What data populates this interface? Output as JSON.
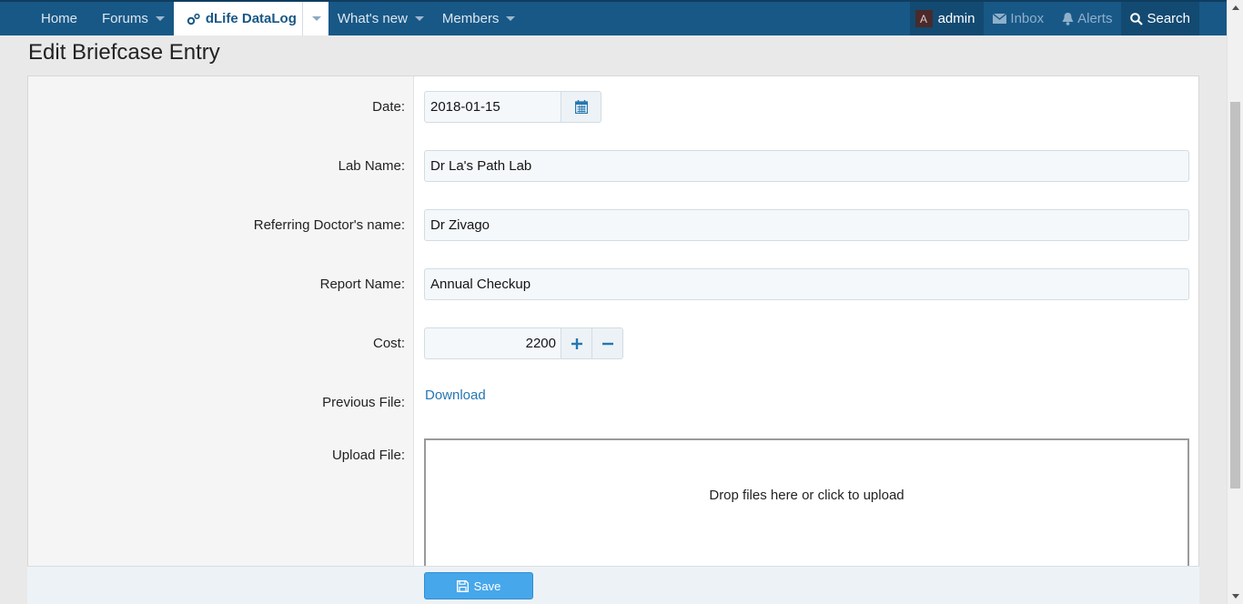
{
  "nav": {
    "items": [
      {
        "label": "Home"
      },
      {
        "label": "Forums"
      },
      {
        "label": "dLife DataLog"
      },
      {
        "label": "What's new"
      },
      {
        "label": "Members"
      }
    ],
    "user": {
      "avatar_letter": "A",
      "name": "admin"
    },
    "inbox_label": "Inbox",
    "alerts_label": "Alerts",
    "search_label": "Search"
  },
  "page": {
    "title": "Edit Briefcase Entry"
  },
  "form": {
    "date": {
      "label": "Date:",
      "value": "2018-01-15"
    },
    "lab_name": {
      "label": "Lab Name:",
      "value": "Dr La's Path Lab"
    },
    "doctor": {
      "label": "Referring Doctor's name:",
      "value": "Dr Zivago"
    },
    "report": {
      "label": "Report Name:",
      "value": "Annual Checkup"
    },
    "cost": {
      "label": "Cost:",
      "value": "2200"
    },
    "previous_file": {
      "label": "Previous File:",
      "link": "Download"
    },
    "upload": {
      "label": "Upload File:",
      "dropzone_text": "Drop files here or click to upload"
    },
    "save_label": "Save"
  },
  "colors": {
    "nav_bg": "#185886",
    "link": "#2577b1",
    "save": "#47a7eb"
  }
}
